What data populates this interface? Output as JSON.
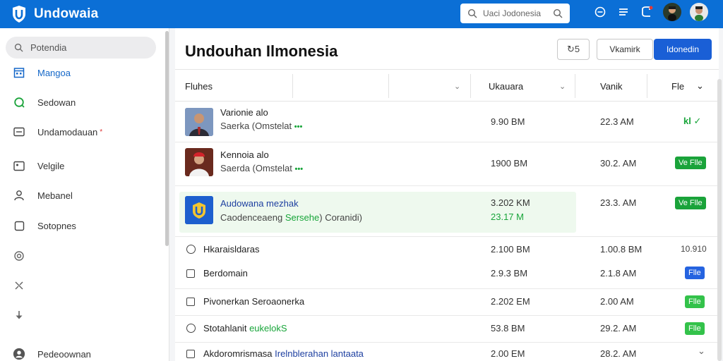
{
  "app": {
    "name": "Undowaia",
    "search_placeholder": "Uaci Jodonesia"
  },
  "sidebar": {
    "search_label": "Potendia",
    "items": [
      {
        "label": "Mangoa",
        "icon": "grid-calendar-icon",
        "active": true
      },
      {
        "label": "Sedowan",
        "icon": "refresh-q-icon"
      },
      {
        "label": "Undamodauan",
        "icon": "card-icon",
        "badge": "*"
      },
      {
        "label": "Velgile",
        "icon": "image-frame-icon"
      },
      {
        "label": "Mebanel",
        "icon": "user-icon"
      },
      {
        "label": "Sotopnes",
        "icon": "square-icon"
      },
      {
        "label": "",
        "icon": "settings-circle-icon"
      },
      {
        "label": "",
        "icon": "pin-icon"
      },
      {
        "label": "",
        "icon": "arrow-down-icon"
      },
      {
        "label": "Pedeoownan",
        "icon": "profile-icon"
      }
    ]
  },
  "main": {
    "title": "Undouhan Ilmonesia",
    "icon_button_label": "↻5",
    "secondary_button": "Vkamirk",
    "primary_button": "Idonedin",
    "columns": {
      "name": "Fluhes",
      "size": "Ukauara",
      "modified": "Vanik",
      "file": "Fle"
    },
    "rows": [
      {
        "name": "Varionie alo",
        "sub": "Saerka (Omstelat",
        "sub_extra": "•••",
        "size": "9.90 BM",
        "time": "22.3 AM",
        "action": "kl ✓"
      },
      {
        "name": "Kennoia alo",
        "sub": "Saerda (Omstelat",
        "sub_extra": "•••",
        "size": "1900 BM",
        "time": "30.2. AM",
        "action": "Ve Flle"
      },
      {
        "name": "Audowana mezhak",
        "sub": "Caodenceaeng",
        "sub_green": "Sersehe",
        "sub_end": ") Coranidi)",
        "size": "3.202 KM",
        "size2": "23.17 M",
        "time": "23.3. AM",
        "action": "Ve Flle"
      },
      {
        "name": "Hkaraisldaras",
        "size": "2.100 BM",
        "time": "1.00.8 BM",
        "action": "10.910"
      },
      {
        "name": "Berdomain",
        "size": "2.9.3 BM",
        "time": "2.1.8 AM",
        "action": "Flle"
      },
      {
        "name": "Pivonerkan Seroaonerka",
        "size": "2.202 EM",
        "time": "2.00 AM",
        "action": "Flle"
      },
      {
        "name": "Stotahlanit",
        "name_green": "eukelokS",
        "size": "53.8 BM",
        "time": "29.2. AM",
        "action": "Flle"
      },
      {
        "name": "Akdoromrismasa",
        "name_blue": "Irelnblerahan lantaata",
        "size": "2.00 EM",
        "time": "28.2. AM",
        "action": "⌄"
      }
    ]
  },
  "colors": {
    "topbar": "#0b6fd6",
    "primary": "#1a5fd6",
    "success": "#1aa33a"
  }
}
